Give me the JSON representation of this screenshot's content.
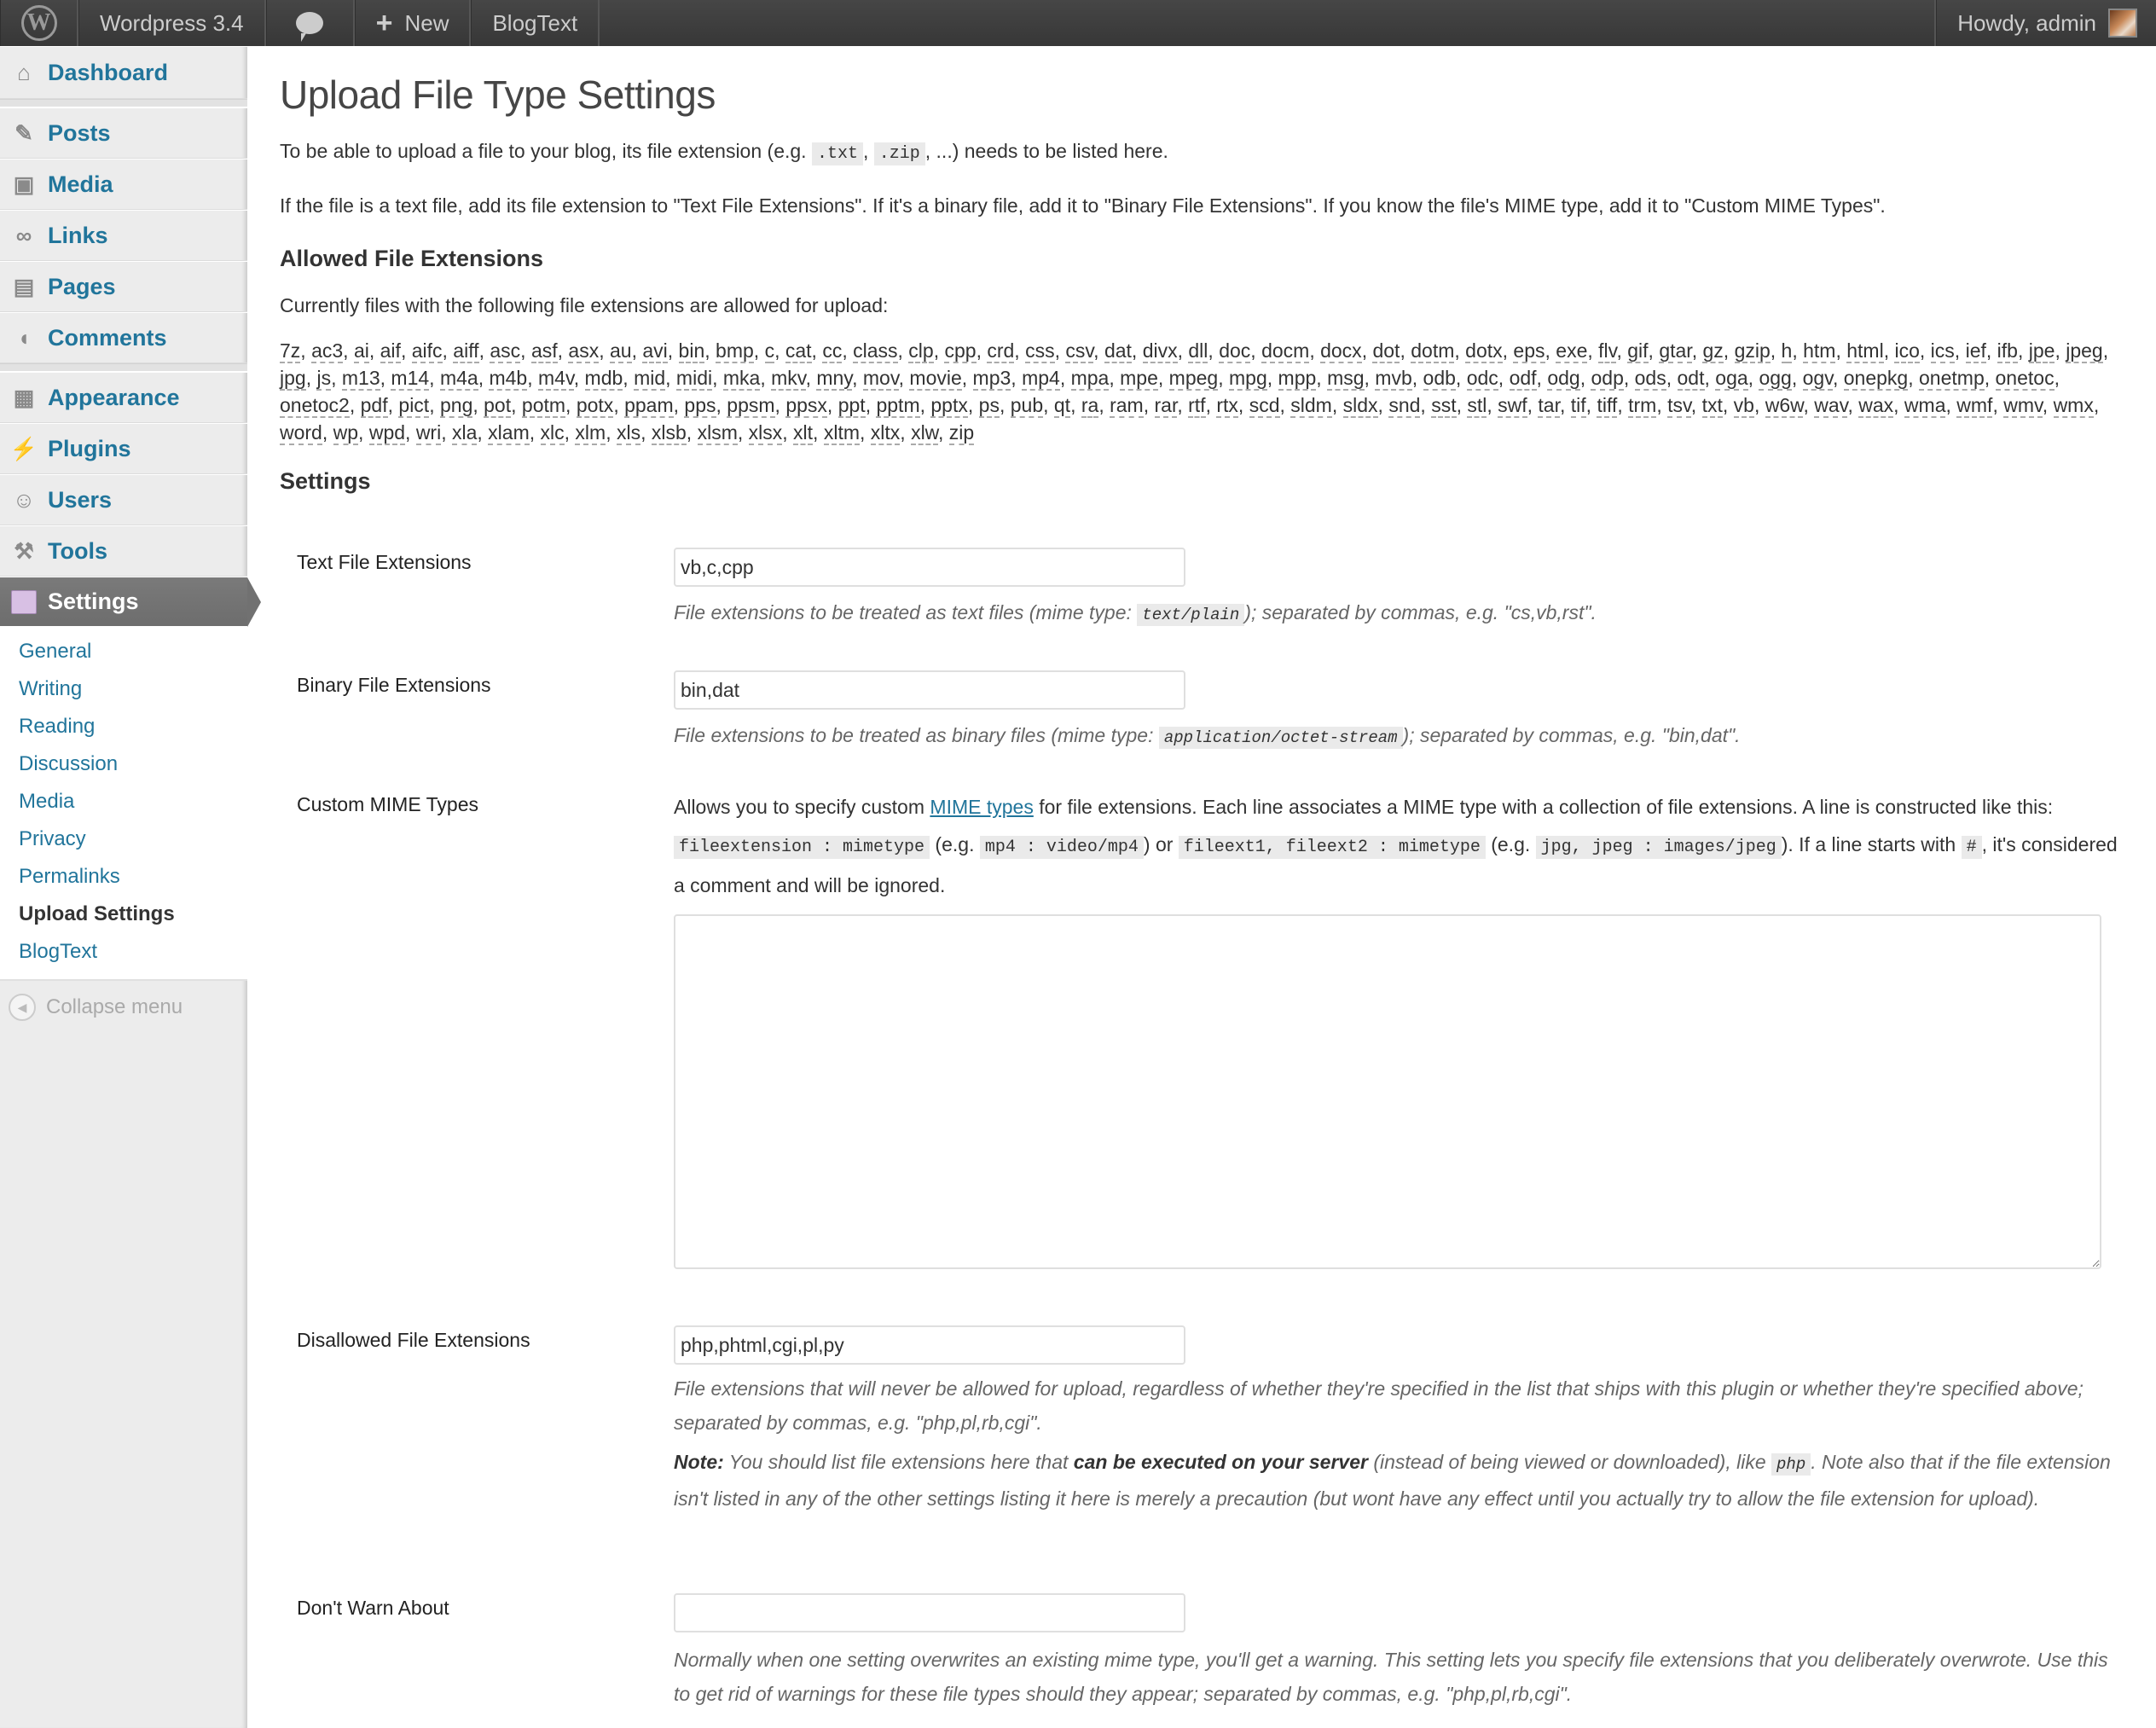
{
  "adminbar": {
    "site_name": "Wordpress 3.4",
    "new_label": "New",
    "plugin_label": "BlogText",
    "howdy": "Howdy, admin"
  },
  "sidebar": {
    "items": [
      {
        "label": "Dashboard",
        "icon": "dashboard-icon"
      },
      {
        "label": "Posts",
        "icon": "pushpin-icon"
      },
      {
        "label": "Media",
        "icon": "media-icon"
      },
      {
        "label": "Links",
        "icon": "link-icon"
      },
      {
        "label": "Pages",
        "icon": "pages-icon"
      },
      {
        "label": "Comments",
        "icon": "comment-icon"
      },
      {
        "label": "Appearance",
        "icon": "appearance-icon"
      },
      {
        "label": "Plugins",
        "icon": "plugin-icon"
      },
      {
        "label": "Users",
        "icon": "users-icon"
      },
      {
        "label": "Tools",
        "icon": "tools-icon"
      },
      {
        "label": "Settings",
        "icon": "settings-icon"
      }
    ],
    "submenu": [
      {
        "label": "General"
      },
      {
        "label": "Writing"
      },
      {
        "label": "Reading"
      },
      {
        "label": "Discussion"
      },
      {
        "label": "Media"
      },
      {
        "label": "Privacy"
      },
      {
        "label": "Permalinks"
      },
      {
        "label": "Upload Settings",
        "current": true
      },
      {
        "label": "BlogText"
      }
    ],
    "collapse_label": "Collapse menu"
  },
  "page": {
    "title": "Upload File Type Settings",
    "intro1_a": "To be able to upload a file to your blog, its file extension (e.g. ",
    "intro1_code1": ".txt",
    "intro1_sep": ", ",
    "intro1_code2": ".zip",
    "intro1_b": ", ...) needs to be listed here.",
    "intro2": "If the file is a text file, add its file extension to \"Text File Extensions\". If it's a binary file, add it to \"Binary File Extensions\". If you know the file's MIME type, add it to \"Custom MIME Types\".",
    "allowed_heading": "Allowed File Extensions",
    "currently_text": "Currently files with the following file extensions are allowed for upload:",
    "allowed_extensions": [
      "7z",
      "ac3",
      "ai",
      "aif",
      "aifc",
      "aiff",
      "asc",
      "asf",
      "asx",
      "au",
      "avi",
      "bin",
      "bmp",
      "c",
      "cat",
      "cc",
      "class",
      "clp",
      "cpp",
      "crd",
      "css",
      "csv",
      "dat",
      "divx",
      "dll",
      "doc",
      "docm",
      "docx",
      "dot",
      "dotm",
      "dotx",
      "eps",
      "exe",
      "flv",
      "gif",
      "gtar",
      "gz",
      "gzip",
      "h",
      "htm",
      "html",
      "ico",
      "ics",
      "ief",
      "ifb",
      "jpe",
      "jpeg",
      "jpg",
      "js",
      "m13",
      "m14",
      "m4a",
      "m4b",
      "m4v",
      "mdb",
      "mid",
      "midi",
      "mka",
      "mkv",
      "mny",
      "mov",
      "movie",
      "mp3",
      "mp4",
      "mpa",
      "mpe",
      "mpeg",
      "mpg",
      "mpp",
      "msg",
      "mvb",
      "odb",
      "odc",
      "odf",
      "odg",
      "odp",
      "ods",
      "odt",
      "oga",
      "ogg",
      "ogv",
      "onepkg",
      "onetmp",
      "onetoc",
      "onetoc2",
      "pdf",
      "pict",
      "png",
      "pot",
      "potm",
      "potx",
      "ppam",
      "pps",
      "ppsm",
      "ppsx",
      "ppt",
      "pptm",
      "pptx",
      "ps",
      "pub",
      "qt",
      "ra",
      "ram",
      "rar",
      "rtf",
      "rtx",
      "scd",
      "sldm",
      "sldx",
      "snd",
      "sst",
      "stl",
      "swf",
      "tar",
      "tif",
      "tiff",
      "trm",
      "tsv",
      "txt",
      "vb",
      "w6w",
      "wav",
      "wax",
      "wma",
      "wmf",
      "wmv",
      "wmx",
      "word",
      "wp",
      "wpd",
      "wri",
      "xla",
      "xlam",
      "xlc",
      "xlm",
      "xls",
      "xlsb",
      "xlsm",
      "xlsx",
      "xlt",
      "xltm",
      "xltx",
      "xlw",
      "zip"
    ],
    "settings_heading": "Settings"
  },
  "settings": {
    "text_ext": {
      "label": "Text File Extensions",
      "value": "vb,c,cpp",
      "desc_a": "File extensions to be treated as text files (mime type: ",
      "desc_code": "text/plain",
      "desc_b": "); separated by commas, e.g. \"cs,vb,rst\"."
    },
    "binary_ext": {
      "label": "Binary File Extensions",
      "value": "bin,dat",
      "desc_a": "File extensions to be treated as binary files (mime type: ",
      "desc_code": "application/octet-stream",
      "desc_b": "); separated by commas, e.g. \"bin,dat\"."
    },
    "custom_mime": {
      "label": "Custom MIME Types",
      "desc_a": "Allows you to specify custom ",
      "link": "MIME types",
      "desc_b": " for file extensions. Each line associates a MIME type with a collection of file extensions. A line is constructed like this: ",
      "code1": "fileextension : mimetype",
      "desc_c": " (e.g. ",
      "code2": "mp4 : video/mp4",
      "desc_d": ") or ",
      "code3": "fileext1, fileext2 : mimetype",
      "desc_e": " (e.g. ",
      "code4": "jpg, jpeg : images/jpeg",
      "desc_f": "). If a line starts with ",
      "code5": "#",
      "desc_g": ", it's considered a comment and will be ignored.",
      "value": ""
    },
    "disallowed_ext": {
      "label": "Disallowed File Extensions",
      "value": "php,phtml,cgi,pl,py",
      "desc": "File extensions that will never be allowed for upload, regardless of whether they're specified in the list that ships with this plugin or whether they're specified above; separated by commas, e.g. \"php,pl,rb,cgi\".",
      "note_label": "Note:",
      "note_a": " You should list file extensions here that ",
      "note_bold": "can be executed on your server",
      "note_b": " (instead of being viewed or downloaded), like ",
      "note_code": "php",
      "note_c": ". Note also that if the file extension isn't listed in any of the other settings listing it here is merely a precaution (but wont have any effect until you actually try to allow the file extension for upload)."
    },
    "dont_warn": {
      "label": "Don't Warn About",
      "value": "",
      "desc": "Normally when one setting overwrites an existing mime type, you'll get a warning. This setting lets you specify file extensions that you deliberately overwrote. Use this to get rid of warnings for these file types should they appear; separated by commas, e.g. \"php,pl,rb,cgi\"."
    }
  },
  "colors": {
    "link": "#21759b",
    "adminbar_bg": "#464646",
    "sidebar_bg": "#ececec",
    "current_menu_bg": "#777777"
  }
}
